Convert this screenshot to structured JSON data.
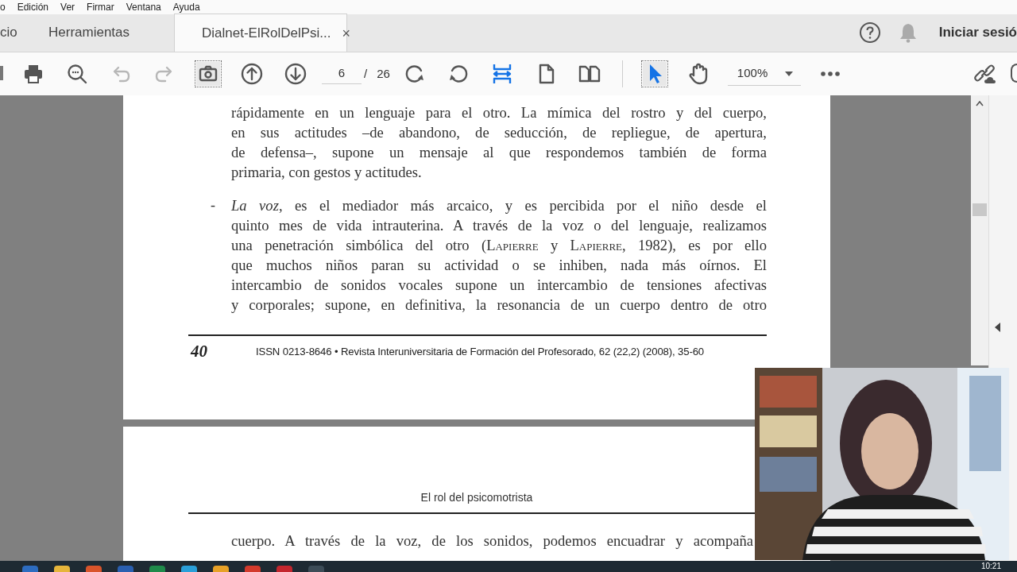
{
  "menu": [
    "o",
    "Edición",
    "Ver",
    "Firmar",
    "Ventana",
    "Ayuda"
  ],
  "tabs": [
    {
      "label": "cio",
      "selected": false
    },
    {
      "label": "Herramientas",
      "selected": false
    },
    {
      "label": "Dialnet-ElRolDelPsi...",
      "selected": true,
      "close": "×"
    }
  ],
  "account": {
    "sign_in": "Iniciar sesió"
  },
  "toolbar": {
    "tools": [
      {
        "selected": false,
        "disabled": false
      },
      {
        "selected": false,
        "disabled": false
      },
      {
        "selected": false,
        "disabled": true
      },
      {
        "selected": false,
        "disabled": true
      },
      {
        "selected": true,
        "disabled": false
      },
      {
        "selected": false,
        "disabled": false
      },
      {
        "selected": false,
        "disabled": false
      },
      {
        "selected": false,
        "disabled": false
      },
      {
        "selected": false,
        "disabled": false
      },
      {
        "selected": false,
        "disabled": false
      },
      {
        "selected": false,
        "disabled": false
      },
      {
        "selected": false,
        "disabled": false
      },
      {
        "selected": true,
        "disabled": false
      },
      {
        "selected": false,
        "disabled": false
      }
    ],
    "page": {
      "value": "6",
      "separator": "/",
      "count": "26"
    },
    "zoom": {
      "value": "100%"
    }
  },
  "document": {
    "pages": [
      {
        "blocks": [
          {
            "kind": "paragraph",
            "continues": false,
            "lines": [
              "rápidamente en un lenguaje para el otro. La mímica del rostro y del cuerpo,",
              "en sus actitudes –de abandono, de seducción, de repliegue, de apertura,",
              "de defensa–, supone un mensaje al que respondemos también de forma",
              "primaria, con gestos y actitudes."
            ]
          },
          {
            "kind": "list-item",
            "marker": "-",
            "continues": true,
            "lines": [
              "*La voz*, es el mediador más arcaico, y es percibida por el niño desde el",
              "quinto mes de vida intrauterina. A través de la voz o del lenguaje, realizamos",
              [
                {
                  "text": "una penetración simbólica del otro (",
                  "kind": "text"
                },
                {
                  "text": "Lapierre",
                  "kind": "author"
                },
                {
                  "text": " y ",
                  "kind": "text"
                },
                {
                  "text": "Lapierre",
                  "kind": "author"
                },
                {
                  "text": ", 1982), es por ello",
                  "kind": "text"
                }
              ],
              "que muchos niños paran su actividad o se inhiben, nada más oírnos. El",
              "intercambio de sonidos vocales supone un intercambio de tensiones afectivas",
              "y corporales; supone, en definitiva, la resonancia de un cuerpo dentro de otro"
            ]
          }
        ],
        "footer": {
          "number": "40",
          "citation": "ISSN 0213-8646 • Revista Interuniversitaria de Formación del Profesorado, 62 (22,2) (2008), 35-60"
        }
      },
      {
        "header": "El rol del psicomotrista",
        "blocks": [
          {
            "kind": "paragraph",
            "continues": true,
            "lines": [
              "cuerpo. A través de la voz, de los sonidos, podemos encuadrar y acompaña"
            ]
          }
        ]
      }
    ]
  },
  "taskbar": {
    "clock": "10:21"
  }
}
